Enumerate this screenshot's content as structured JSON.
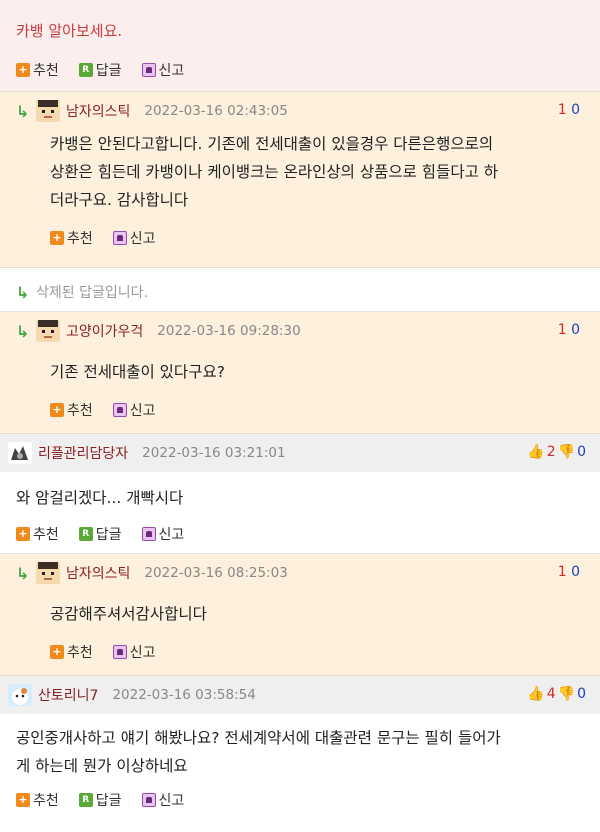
{
  "post": {
    "title": "카뱅 알아보세요.",
    "actions": {
      "recommend": "추천",
      "reply": "답글",
      "report": "신고"
    }
  },
  "comments": [
    {
      "nick": "남자의스틱",
      "date": "2022-03-16 02:43:05",
      "up": "1",
      "down": "0",
      "text": "카뱅은 안된다고합니다. 기존에 전세대출이 있을경우 다른은행으로의 상환은 힘든데 카뱅이나 케이뱅크는 온라인상의 상품으로 힘들다고 하더라구요. 감사합니다",
      "lines": [
        "카뱅은 안된다고합니다. 기존에 전세대출이 있을경우 다른은행으로의",
        "상환은 힘든데 카뱅이나 케이뱅크는 온라인상의 상품으로 힘들다고 하",
        "더라구요. 감사합니다"
      ],
      "recommend": "추천",
      "report": "신고"
    },
    {
      "deleted_text": "삭제된 답글입니다."
    },
    {
      "nick": "고양이가우걱",
      "date": "2022-03-16 09:28:30",
      "up": "1",
      "down": "0",
      "text": "기존 전세대출이 있다구요?",
      "recommend": "추천",
      "report": "신고"
    },
    {
      "nick": "리플관리담당자",
      "date": "2022-03-16 03:21:01",
      "up": "2",
      "down": "0",
      "text": "와 암걸리겠다... 개빡시다",
      "recommend": "추천",
      "reply": "답글",
      "report": "신고"
    },
    {
      "nick": "남자의스틱",
      "date": "2022-03-16 08:25:03",
      "up": "1",
      "down": "0",
      "text": "공감해주셔서감사합니다",
      "recommend": "추천",
      "report": "신고"
    },
    {
      "nick": "산토리니7",
      "date": "2022-03-16 03:58:54",
      "up": "4",
      "down": "0",
      "lines": [
        "공인중개사하고 얘기 해봤나요? 전세계약서에 대출관련 문구는 필히 들어가",
        "게 하는데 뭔가 이상하네요"
      ],
      "recommend": "추천",
      "reply": "답글",
      "report": "신고"
    }
  ]
}
